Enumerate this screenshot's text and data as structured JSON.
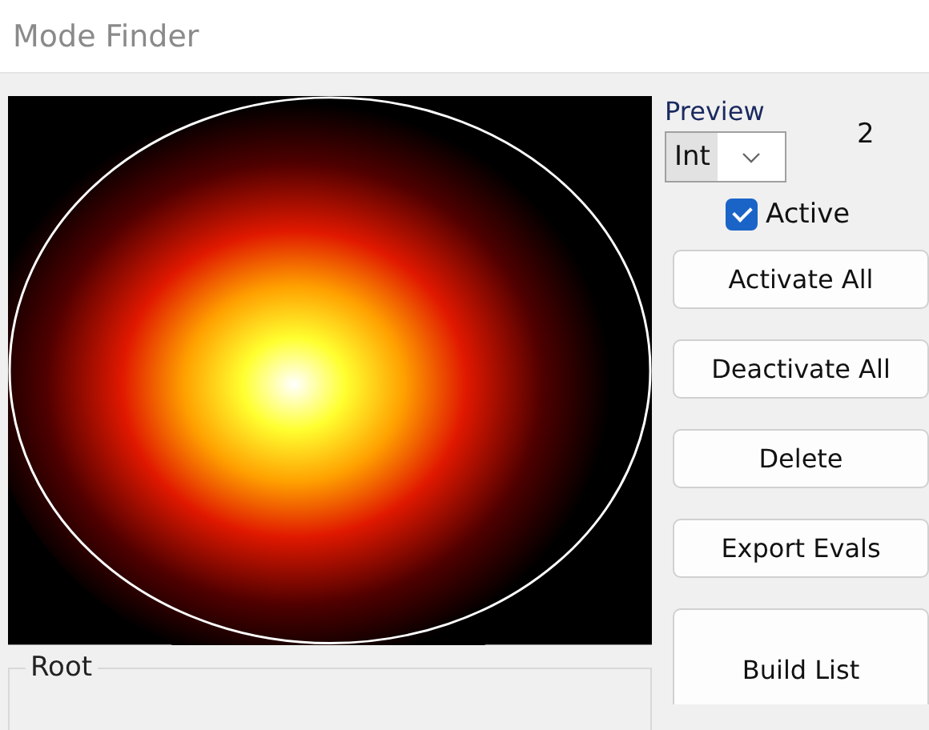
{
  "window": {
    "title": "Mode Finder"
  },
  "preview": {
    "label": "Preview",
    "mode": "Int",
    "count": "2"
  },
  "active": {
    "label": "Active",
    "checked": true
  },
  "buttons": [
    {
      "label": "Activate All"
    },
    {
      "label": "Deactivate All"
    },
    {
      "label": "Delete"
    },
    {
      "label": "Export Evals"
    },
    {
      "label": "Build List"
    }
  ],
  "group": {
    "label": "Root"
  }
}
